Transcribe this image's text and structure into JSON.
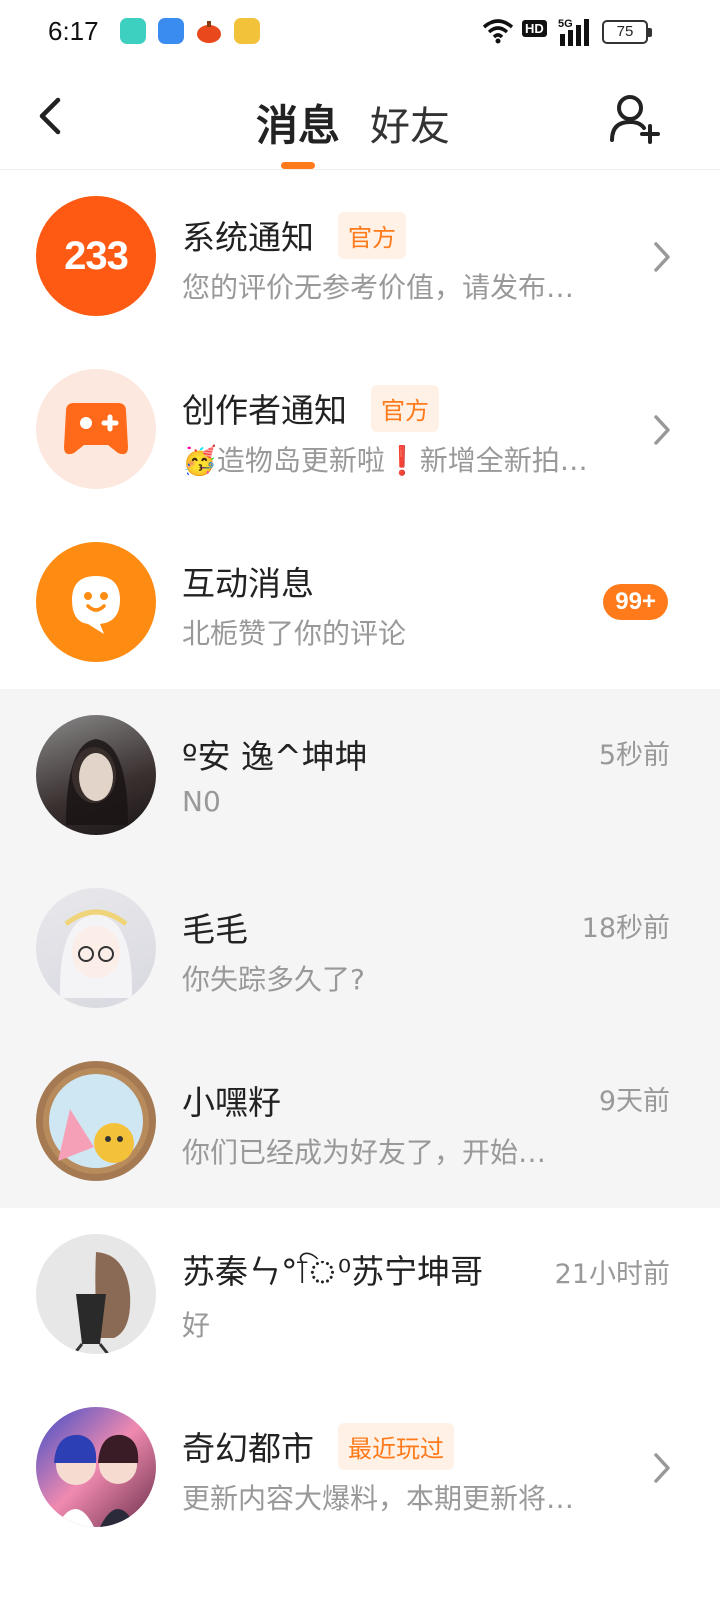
{
  "status_bar": {
    "time": "6:17",
    "network": "5G",
    "hd": "HD",
    "battery": "75"
  },
  "header": {
    "tabs": [
      {
        "label": "消息",
        "active": true
      },
      {
        "label": "好友",
        "active": false
      }
    ]
  },
  "conversations": [
    {
      "name": "系统通知",
      "tag": "官方",
      "preview": "您的评价无参考价值，请发布…",
      "avatar_text": "233",
      "has_chevron": true
    },
    {
      "name": "创作者通知",
      "tag": "官方",
      "preview": "🥳造物岛更新啦❗新增全新拍…",
      "has_chevron": true
    },
    {
      "name": "互动消息",
      "preview": "北栀赞了你的评论",
      "count": "99+"
    },
    {
      "name": "º安  逸^坤坤",
      "preview": "N0",
      "time": "5秒前"
    },
    {
      "name": "毛毛",
      "preview": "你失踪多久了?",
      "time": "18秒前"
    },
    {
      "name": "小嘿籽",
      "preview": "你们已经成为好友了，开始…",
      "time": "9天前"
    },
    {
      "name": "苏秦ㄣ°ি⁰苏宁坤哥",
      "preview": "好",
      "time": "21小时前"
    },
    {
      "name": "奇幻都市",
      "tag": "最近玩过",
      "preview": "更新内容大爆料，本期更新将…",
      "has_chevron": true
    }
  ],
  "colors": {
    "accent": "#ff7a1a",
    "tag_bg": "#fff1e6",
    "gray_row": "#f5f5f5"
  }
}
